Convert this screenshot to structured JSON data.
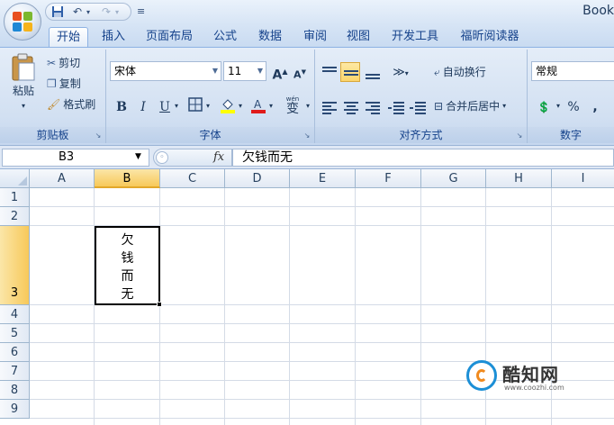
{
  "window": {
    "title": "Book"
  },
  "colors": {
    "ribbon": "#d2e0f2",
    "selection": "#f7c95a",
    "font_color_bar": "#e01b1b",
    "highlight_bar": "#ffff00"
  },
  "tabs": [
    {
      "label": "开始",
      "active": true
    },
    {
      "label": "插入"
    },
    {
      "label": "页面布局"
    },
    {
      "label": "公式"
    },
    {
      "label": "数据"
    },
    {
      "label": "审阅"
    },
    {
      "label": "视图"
    },
    {
      "label": "开发工具"
    },
    {
      "label": "福昕阅读器"
    }
  ],
  "ribbon": {
    "clipboard": {
      "label": "剪贴板",
      "paste": "粘贴",
      "cut": "剪切",
      "copy": "复制",
      "format_painter": "格式刷"
    },
    "font": {
      "label": "字体",
      "font_name": "宋体",
      "font_size": "11",
      "bold": "B",
      "italic": "I",
      "underline": "U",
      "phonetic": "wén",
      "phonetic_char": "变"
    },
    "alignment": {
      "label": "对齐方式",
      "wrap_text": "自动换行",
      "merge_center": "合并后居中"
    },
    "number": {
      "label": "数字",
      "format": "常规",
      "percent": "%",
      "comma": ","
    }
  },
  "formula_bar": {
    "name_box": "B3",
    "fx": "fx",
    "content": "欠钱而无"
  },
  "grid": {
    "columns": [
      "A",
      "B",
      "C",
      "D",
      "E",
      "F",
      "G",
      "H",
      "I"
    ],
    "rows": [
      "1",
      "2",
      "3",
      "4",
      "5",
      "6",
      "7",
      "8",
      "9"
    ],
    "selected_column": "B",
    "selected_row": "3",
    "active_cell_text": "欠\n钱\n而\n无"
  },
  "watermark": {
    "name": "酷知网",
    "url": "www.coozhi.com"
  }
}
